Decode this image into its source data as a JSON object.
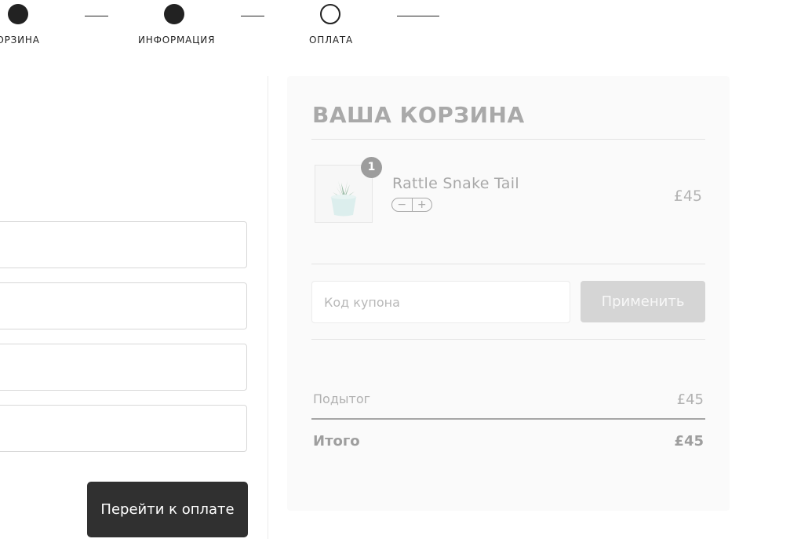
{
  "steps": [
    {
      "label": "КОРЗИНА",
      "state": "done"
    },
    {
      "label": "ИНФОРМАЦИЯ",
      "state": "done"
    },
    {
      "label": "ОПЛАТА",
      "state": "current"
    }
  ],
  "form": {
    "fields": [
      {
        "value": "",
        "placeholder": ""
      },
      {
        "value": "",
        "placeholder": ""
      },
      {
        "value": "",
        "placeholder": ""
      },
      {
        "value": "",
        "placeholder": ""
      }
    ],
    "submit_label": "Перейти к оплате"
  },
  "cart": {
    "title": "ВАША КОРЗИНА",
    "item": {
      "quantity": "1",
      "name": "Rattle Snake Tail",
      "minus": "−",
      "plus": "+",
      "price": "£45"
    },
    "coupon": {
      "placeholder": "Код купона",
      "apply_label": "Применить"
    },
    "subtotal": {
      "label": "Подытог",
      "value": "£45"
    },
    "total": {
      "label": "Итого",
      "value": "£45"
    }
  },
  "colors": {
    "primary_dark": "#303030",
    "cart_background": "#fafafa",
    "muted_text": "#a8a8a8",
    "disabled_button": "#d5d5d5"
  },
  "icons": [
    "plant-pot-thumbnail"
  ]
}
